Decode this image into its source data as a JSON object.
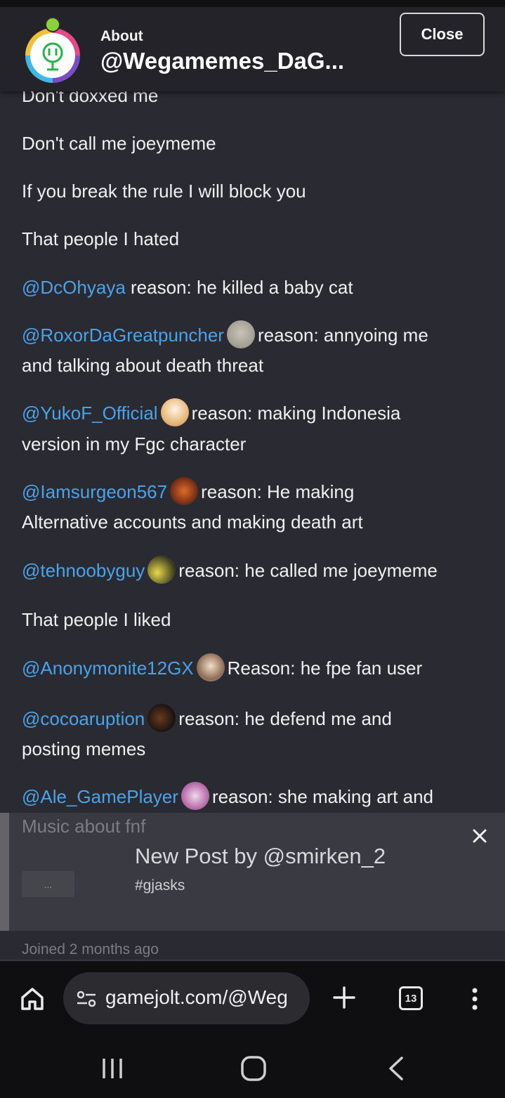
{
  "header": {
    "about_label": "About",
    "username": "@Wegamemes_DaG...",
    "close_label": "Close"
  },
  "bio": {
    "line_dox": "Don't doxxed me",
    "line_call": "Don't call me joeymeme",
    "line_rule": "If you break the rule I will block you",
    "hated_heading": "That people I hated",
    "hated": [
      {
        "handle": "@DcOhyaya",
        "reason": "reason: he killed a baby cat"
      },
      {
        "handle": "@RoxorDaGreatpuncher",
        "reason": "reason: annyoing me",
        "reason_cont": "and talking about death threat"
      },
      {
        "handle": "@YukoF_Official",
        "reason": "reason: making Indonesia",
        "reason_cont": "version in my Fgc character"
      },
      {
        "handle": "@Iamsurgeon567",
        "reason": "reason: He making",
        "reason_cont": "Alternative accounts and making death art"
      },
      {
        "handle": "@tehnoobyguy",
        "reason": "reason: he called me joeymeme"
      }
    ],
    "liked_heading": "That people I liked",
    "liked": [
      {
        "handle": "@Anonymonite12GX",
        "reason": "Reason: he fpe fan user"
      },
      {
        "handle": "@cocoaruption",
        "reason": "reason: he defend me and",
        "reason_cont": "posting memes"
      },
      {
        "handle": "@Ale_GamePlayer",
        "reason": "reason: she making art and"
      }
    ]
  },
  "toast": {
    "background_text": "Music about fnf",
    "more_label": "...",
    "title": "New Post by @smirken_2",
    "tag": "#gjasks"
  },
  "joined_text": "Joined 2 months ago",
  "browser": {
    "url": "gamejolt.com/@Weg",
    "tab_count": "13"
  },
  "colors": {
    "background": "#2a2a33",
    "link": "#4aa3e8",
    "toast": "#3a3a42"
  }
}
